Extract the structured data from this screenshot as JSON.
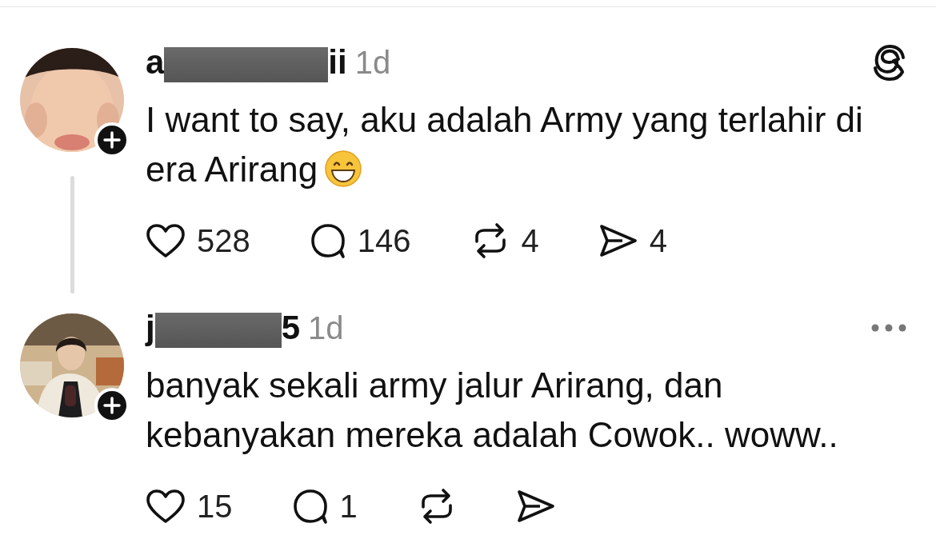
{
  "posts": [
    {
      "username_start": "a",
      "username_end": "ii",
      "time": "1d",
      "corner_icon": {
        "kind": "logo"
      },
      "text_lines": [
        "I want to say, aku adalah Army yang terlahir di",
        "era Arirang"
      ],
      "trailing_emoji": {
        "kind": "grin"
      },
      "thread_line": true,
      "stats": [
        {
          "kind": "like",
          "count": "528"
        },
        {
          "kind": "comment",
          "count": "146"
        },
        {
          "kind": "repost",
          "count": "4"
        },
        {
          "kind": "share",
          "count": "4"
        }
      ]
    },
    {
      "username_start": "j",
      "username_end": "5",
      "time": "1d",
      "corner_icon": {
        "kind": "more"
      },
      "text_lines": [
        "banyak sekali army jalur Arirang, dan",
        "kebanyakan mereka adalah Cowok.. woww.."
      ],
      "stats": [
        {
          "kind": "like",
          "count": "15"
        },
        {
          "kind": "comment",
          "count": "1"
        },
        {
          "kind": "repost"
        },
        {
          "kind": "share"
        }
      ]
    }
  ]
}
